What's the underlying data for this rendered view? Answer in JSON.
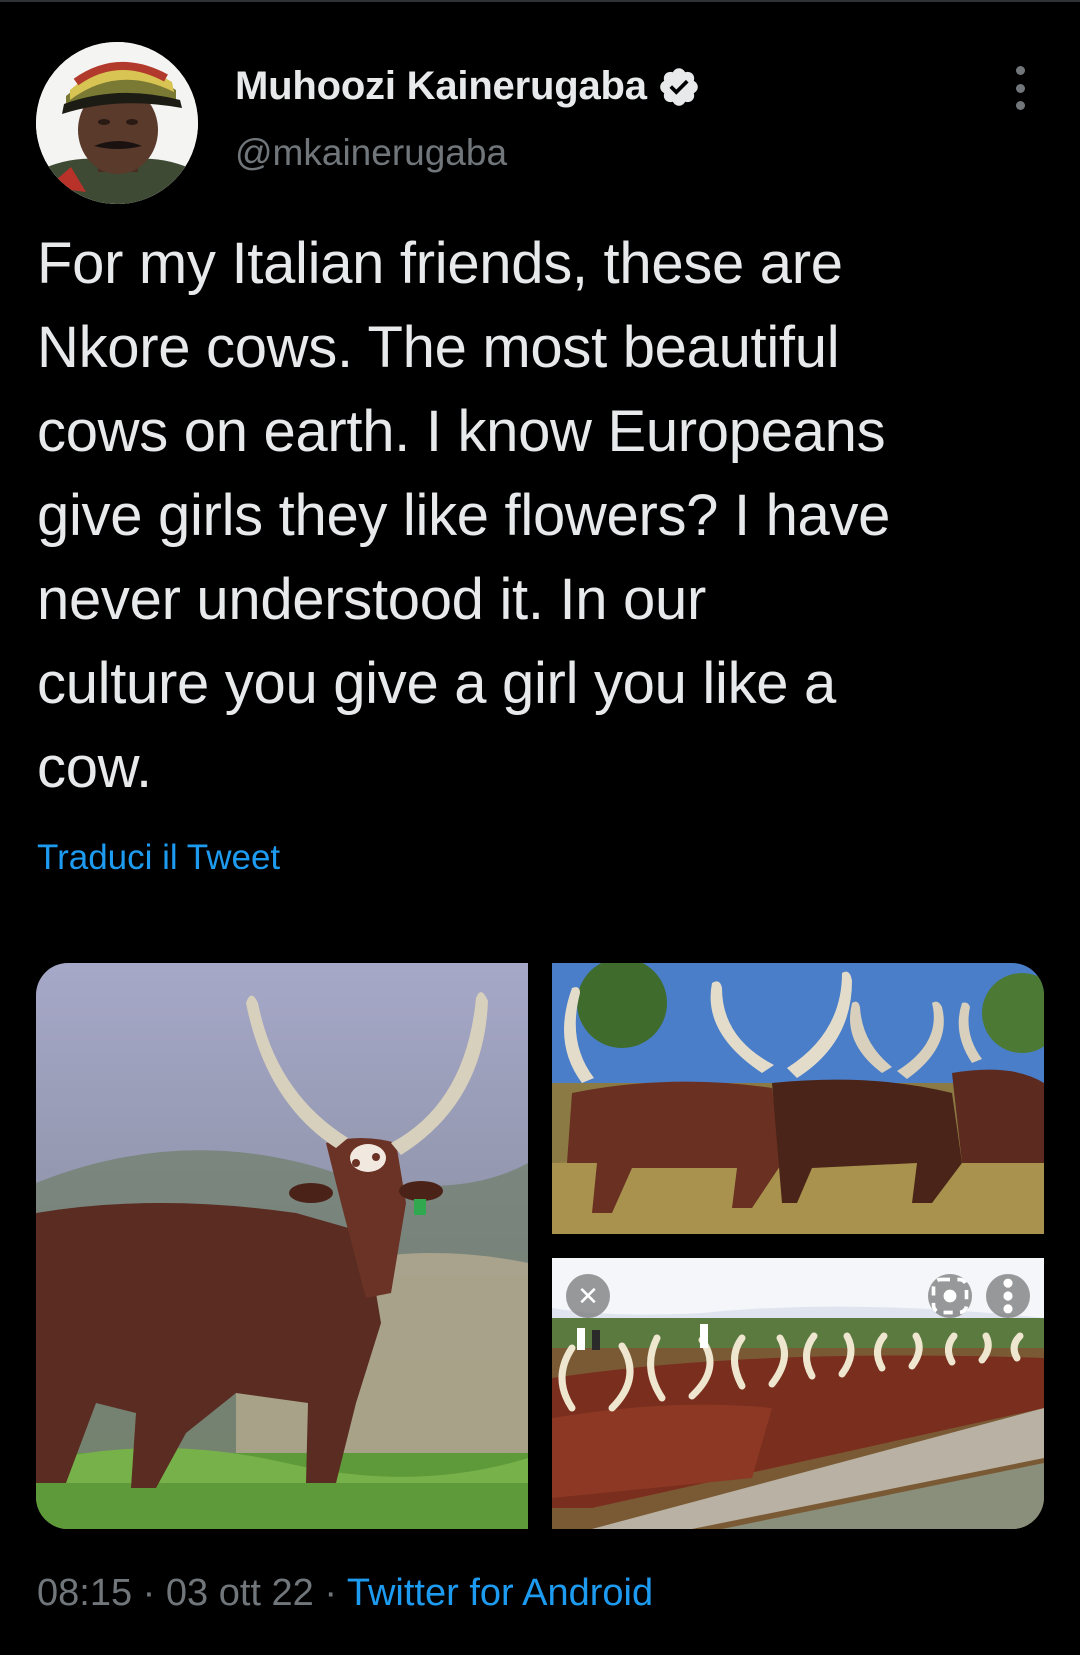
{
  "author": {
    "display_name": "Muhoozi Kainerugaba",
    "handle": "@mkainerugaba",
    "verified": true,
    "avatar_icon": "profile-photo-military-cap"
  },
  "tweet": {
    "text": "For my Italian friends, these are\nNkore cows. The most beautiful\ncows on earth. I know Europeans\ngive girls they like flowers? I have\nnever understood it. In our\nculture you give a girl you like a\ncow.",
    "translate_label": "Traduci il Tweet"
  },
  "media": [
    {
      "description_icon": "ankole-cow-photo"
    },
    {
      "description_icon": "ankole-herd-photo"
    },
    {
      "description_icon": "ankole-cattle-drinking-photo"
    }
  ],
  "meta": {
    "time": "08:15",
    "separator": " · ",
    "date": "03 ott 22",
    "source": "Twitter for Android"
  },
  "colors": {
    "background": "#000000",
    "text_primary": "#e7e9ea",
    "text_secondary": "#71767b",
    "accent_link": "#1d9bf0"
  }
}
